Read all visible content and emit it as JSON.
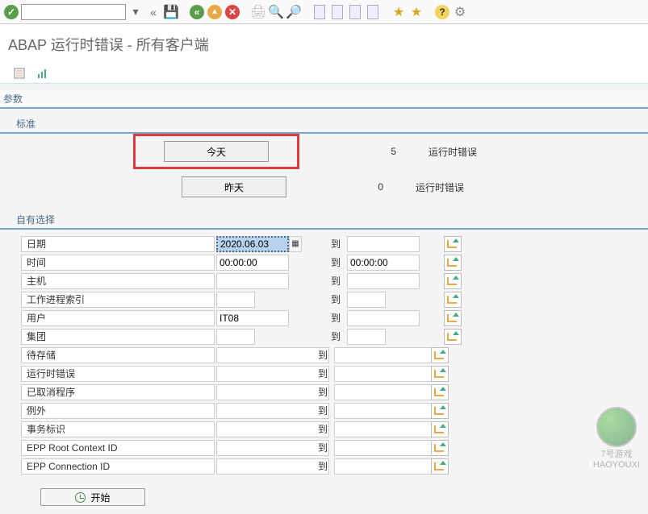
{
  "toolbar": {
    "dropdown_value": ""
  },
  "page_title": "ABAP 运行时错误 - 所有客户端",
  "sections": {
    "params": "参数",
    "standard": "标准",
    "own_selection": "自有选择"
  },
  "standard": {
    "today_button": "今天",
    "yesterday_button": "昨天",
    "today_count": "5",
    "yesterday_count": "0",
    "runtime_error": "运行时错误"
  },
  "fields": {
    "date": "日期",
    "time": "时间",
    "host": "主机",
    "wp_index": "工作进程索引",
    "user": "用户",
    "client": "集团",
    "buffer": "待存储",
    "runtime_error": "运行时错误",
    "cancelled_prog": "已取消程序",
    "exception": "例外",
    "transaction": "事务标识",
    "epp_root": "EPP Root Context ID",
    "epp_conn": "EPP Connection ID"
  },
  "values": {
    "date_from": "2020.06.03",
    "time_from": "00:00:00",
    "time_to": "00:00:00",
    "user_from": "IT08"
  },
  "to_label": "到",
  "start_button": "开始",
  "watermark": {
    "line1": "7号游戏",
    "line2": "HAOYOUXI"
  }
}
